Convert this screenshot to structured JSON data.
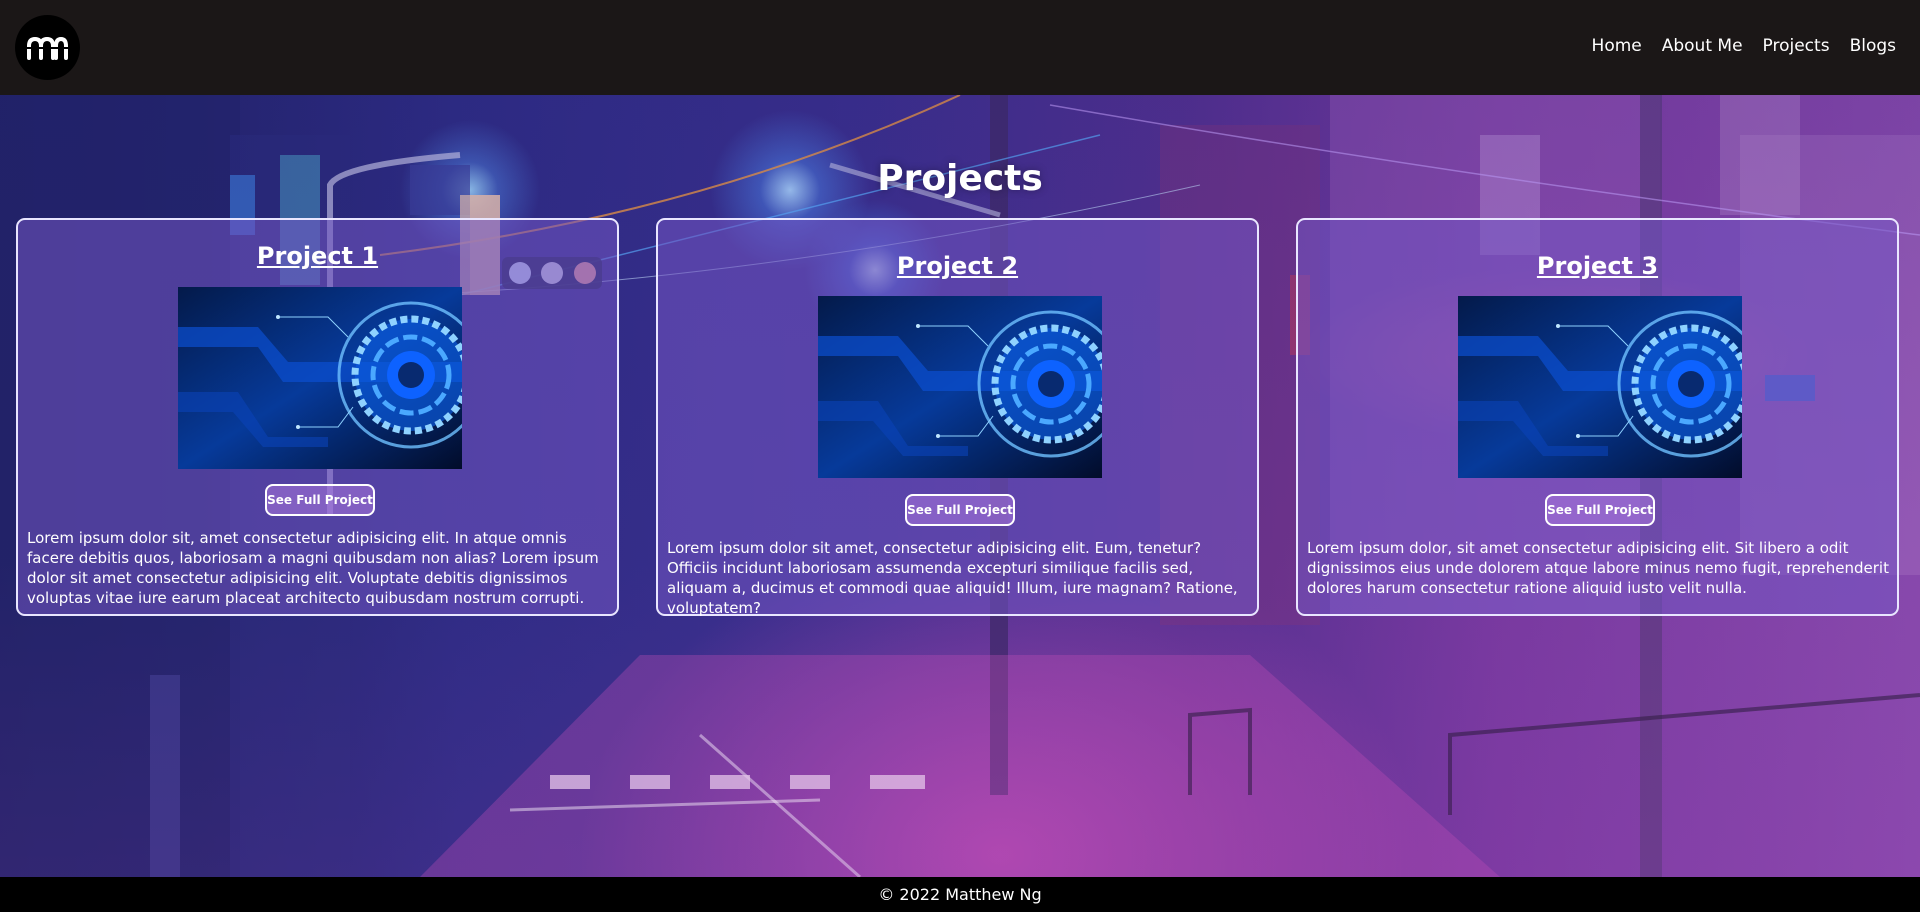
{
  "header": {
    "logo_icon": "mn-monogram-icon",
    "nav": [
      "Home",
      "About Me",
      "Projects",
      "Blogs"
    ]
  },
  "main": {
    "title": "Projects",
    "projects": [
      {
        "title": "Project 1",
        "button_label": "See Full Project",
        "image_icon": "circuit-tech-image",
        "description": "Lorem ipsum dolor sit, amet consectetur adipisicing elit. In atque omnis facere debitis quos, laboriosam a magni quibusdam non alias? Lorem ipsum dolor sit amet consectetur adipisicing elit. Voluptate debitis dignissimos voluptas vitae iure earum placeat architecto quibusdam nostrum corrupti."
      },
      {
        "title": "Project 2",
        "button_label": "See Full Project",
        "image_icon": "circuit-tech-image",
        "description": "Lorem ipsum dolor sit amet, consectetur adipisicing elit. Eum, tenetur? Officiis incidunt laboriosam assumenda excepturi similique facilis sed, aliquam a, ducimus et commodi quae aliquid! Illum, iure magnam? Ratione, voluptatem?"
      },
      {
        "title": "Project 3",
        "button_label": "See Full Project",
        "image_icon": "circuit-tech-image",
        "description": "Lorem ipsum dolor, sit amet consectetur adipisicing elit. Sit libero a odit dignissimos eius unde dolorem atque labore minus nemo fugit, reprehenderit dolores harum consectetur ratione aliquid iusto velit nulla."
      }
    ]
  },
  "footer": {
    "copyright": "© 2022 Matthew Ng"
  },
  "colors": {
    "header_bg": "#1b1717",
    "footer_bg": "#000000",
    "card_border": "#e9e6ff",
    "text": "#ffffff"
  }
}
